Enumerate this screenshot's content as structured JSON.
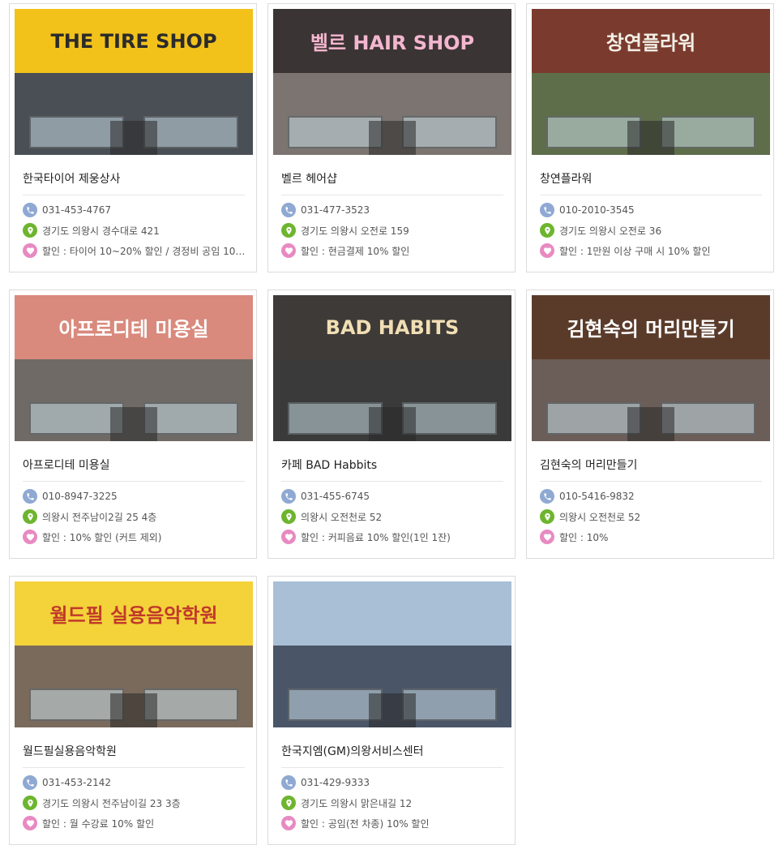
{
  "cards": [
    {
      "name": "한국타이어 제웅상사",
      "phone": "031-453-4767",
      "address": "경기도 의왕시 경수대로 421",
      "discount": "할인 : 타이어 10~20% 할인 / 경정비 공임 10% ...",
      "sign_text": "THE TIRE SHOP",
      "sign_bg": "#f2c21b",
      "sign_fg": "#2b2b2b",
      "front_bg": "#4a4f55"
    },
    {
      "name": "벨르 헤어샵",
      "phone": "031-477-3523",
      "address": "경기도 의왕시 오전로 159",
      "discount": "할인 : 현금결제 10% 할인",
      "sign_text": "벨르 HAIR SHOP",
      "sign_bg": "#3b3434",
      "sign_fg": "#f4b6cf",
      "front_bg": "#7c7470"
    },
    {
      "name": "창연플라워",
      "phone": "010-2010-3545",
      "address": "경기도 의왕시 오전로 36",
      "discount": "할인 : 1만원 이상 구매 시 10% 할인",
      "sign_text": "창연플라워",
      "sign_bg": "#7a3b2e",
      "sign_fg": "#f3efe6",
      "front_bg": "#5f6e4a"
    },
    {
      "name": "아프로디테 미용실",
      "phone": "010-8947-3225",
      "address": "의왕시 전주남이2길 25 4층",
      "discount": "할인 : 10% 할인 (커트 제외)",
      "sign_text": "아프로디테 미용실",
      "sign_bg": "#d98a7d",
      "sign_fg": "#ffffff",
      "front_bg": "#6f6a66"
    },
    {
      "name": "카페 BAD Habbits",
      "phone": "031-455-6745",
      "address": "의왕시 오전천로 52",
      "discount": "할인 : 커피음료 10% 할인(1인 1잔)",
      "sign_text": "BAD HABITS",
      "sign_bg": "#3e3a37",
      "sign_fg": "#f1dfb4",
      "front_bg": "#3a3a3a"
    },
    {
      "name": "김현숙의 머리만들기",
      "phone": "010-5416-9832",
      "address": "의왕시 오전천로 52",
      "discount": "할인 : 10%",
      "sign_text": "김현숙의 머리만들기",
      "sign_bg": "#5a3b2a",
      "sign_fg": "#ffffff",
      "front_bg": "#6b5d57"
    },
    {
      "name": "월드필실용음악학원",
      "phone": "031-453-2142",
      "address": "경기도 의왕시 전주남이길 23 3층",
      "discount": "할인 : 월 수강료 10% 할인",
      "sign_text": "월드필 실용음악학원",
      "sign_bg": "#f4d23a",
      "sign_fg": "#c0392b",
      "front_bg": "#7a6a5c"
    },
    {
      "name": "한국지엠(GM)의왕서비스센터",
      "phone": "031-429-9333",
      "address": "경기도 의왕시 맑은내길 12",
      "discount": "할인 : 공임(전 차종) 10% 할인",
      "sign_text": "",
      "sign_bg": "#a9bfd6",
      "sign_fg": "#ffffff",
      "front_bg": "#4a5568"
    }
  ],
  "icons": {
    "phone": "phone-icon",
    "address": "map-pin-icon",
    "discount": "heart-icon"
  },
  "colors": {
    "phone_icon": "#8fa9d3",
    "address_icon": "#6eb52f",
    "discount_icon": "#e88ac2",
    "card_border": "#dcdcdc"
  }
}
